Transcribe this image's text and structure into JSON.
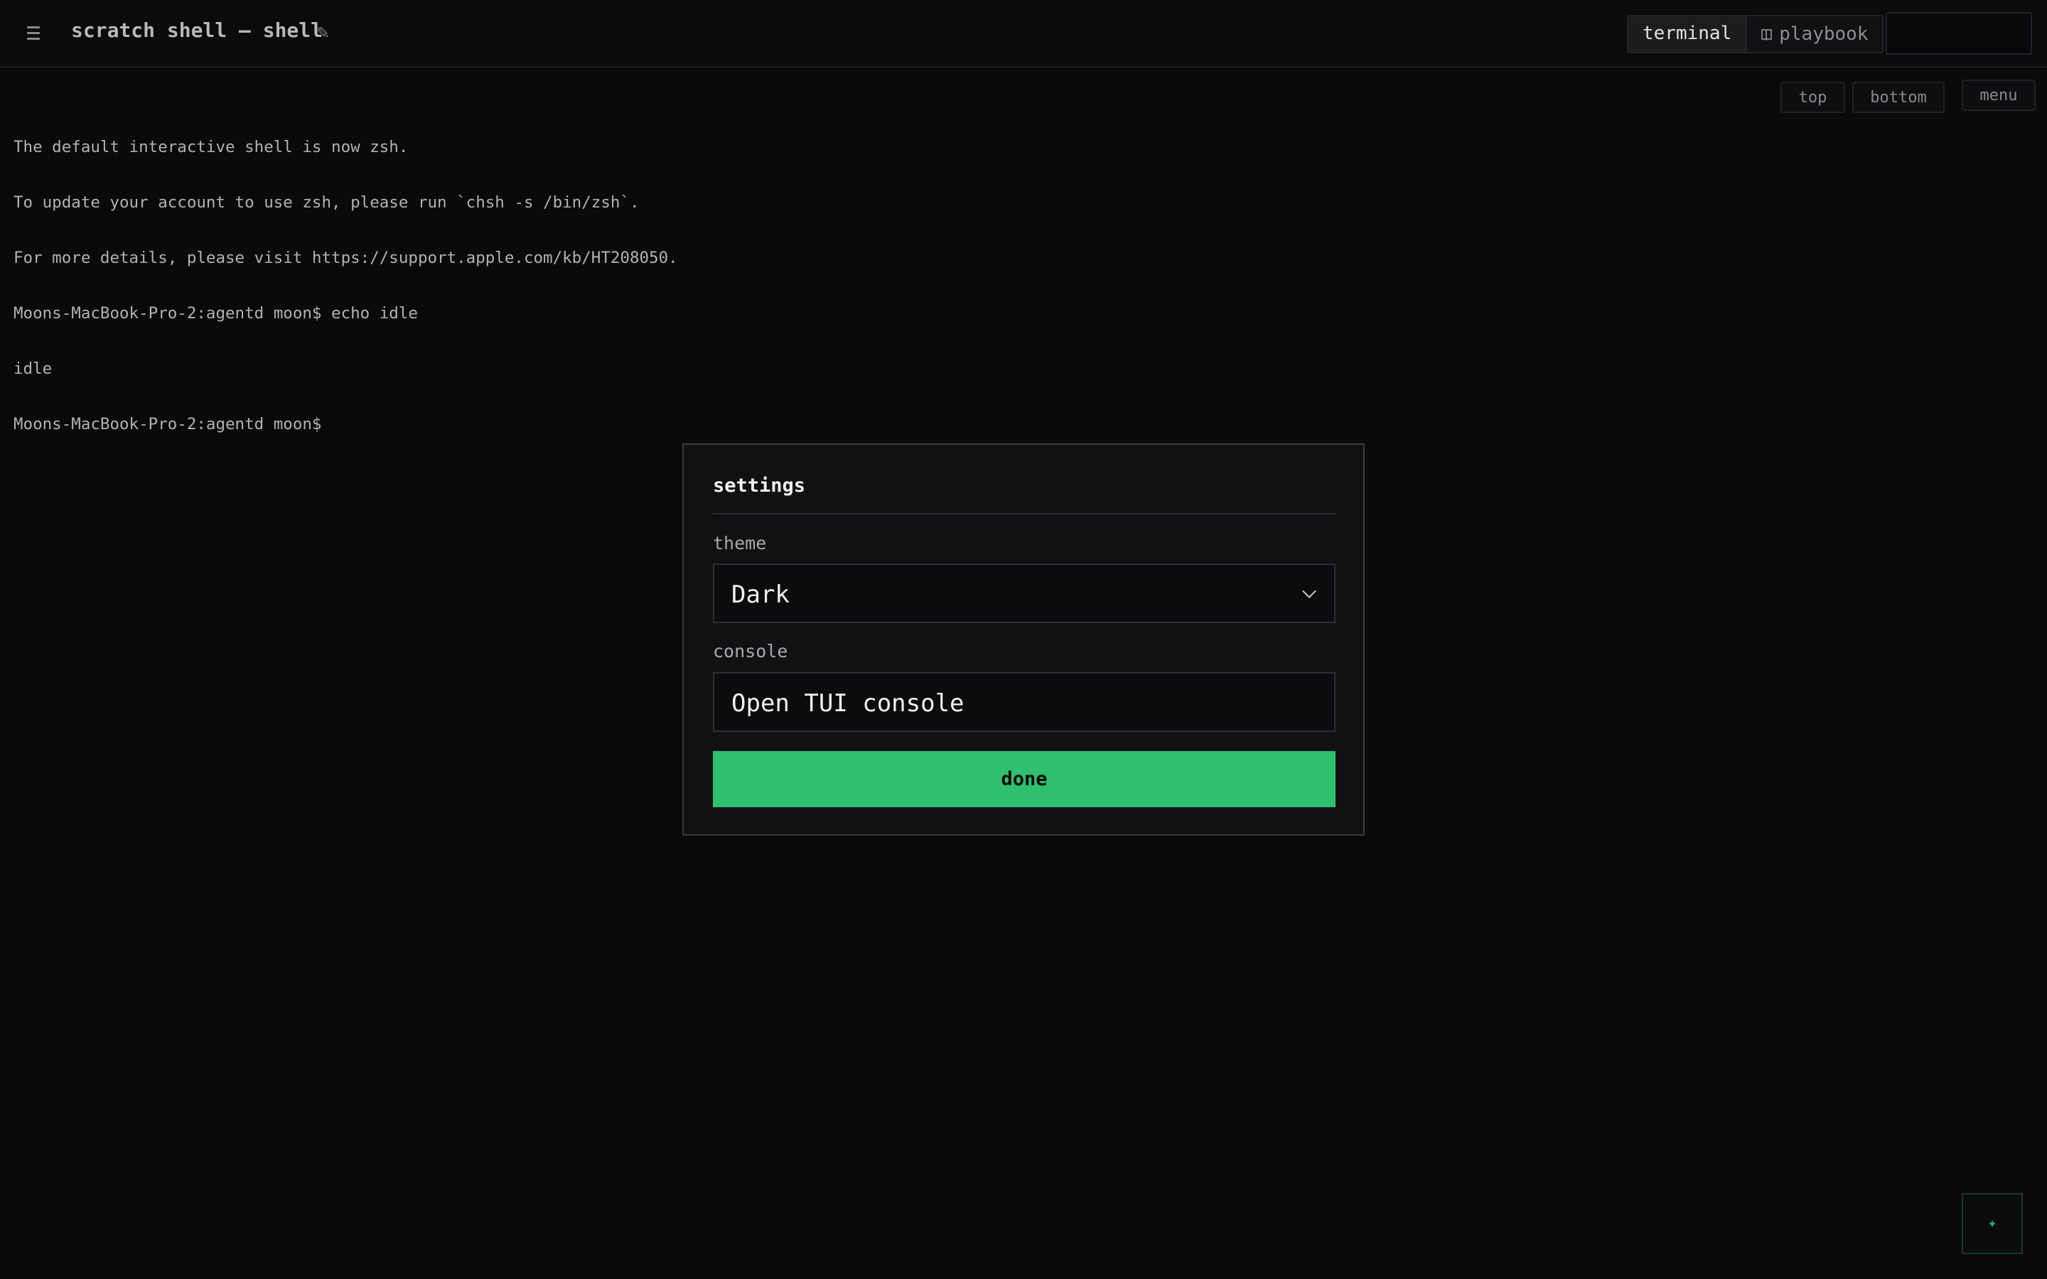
{
  "header": {
    "title": "scratch shell — shell",
    "tabs": [
      {
        "label": "terminal",
        "active": true
      },
      {
        "label": "playbook",
        "active": false
      }
    ]
  },
  "terminal": {
    "lines": [
      "The default interactive shell is now zsh.",
      "To update your account to use zsh, please run `chsh -s /bin/zsh`.",
      "For more details, please visit https://support.apple.com/kb/HT208050.",
      "Moons-MacBook-Pro-2:agentd moon$ echo idle",
      "idle",
      "Moons-MacBook-Pro-2:agentd moon$"
    ],
    "controls": {
      "top_label": "top",
      "bottom_label": "bottom",
      "menu_label": "menu"
    }
  },
  "settings": {
    "title": "settings",
    "theme_label": "theme",
    "theme_value": "Dark",
    "console_label": "console",
    "console_value": "Open TUI console",
    "done_label": "done"
  },
  "fab": {
    "glyph": "✦"
  },
  "colors": {
    "background": "#0a0a0a",
    "accent": "#2ec06f",
    "modal": "#111113"
  },
  "icons": [
    "menu-icon",
    "edit-icon",
    "book-icon",
    "chevron-down-icon",
    "sparkle-icon"
  ]
}
